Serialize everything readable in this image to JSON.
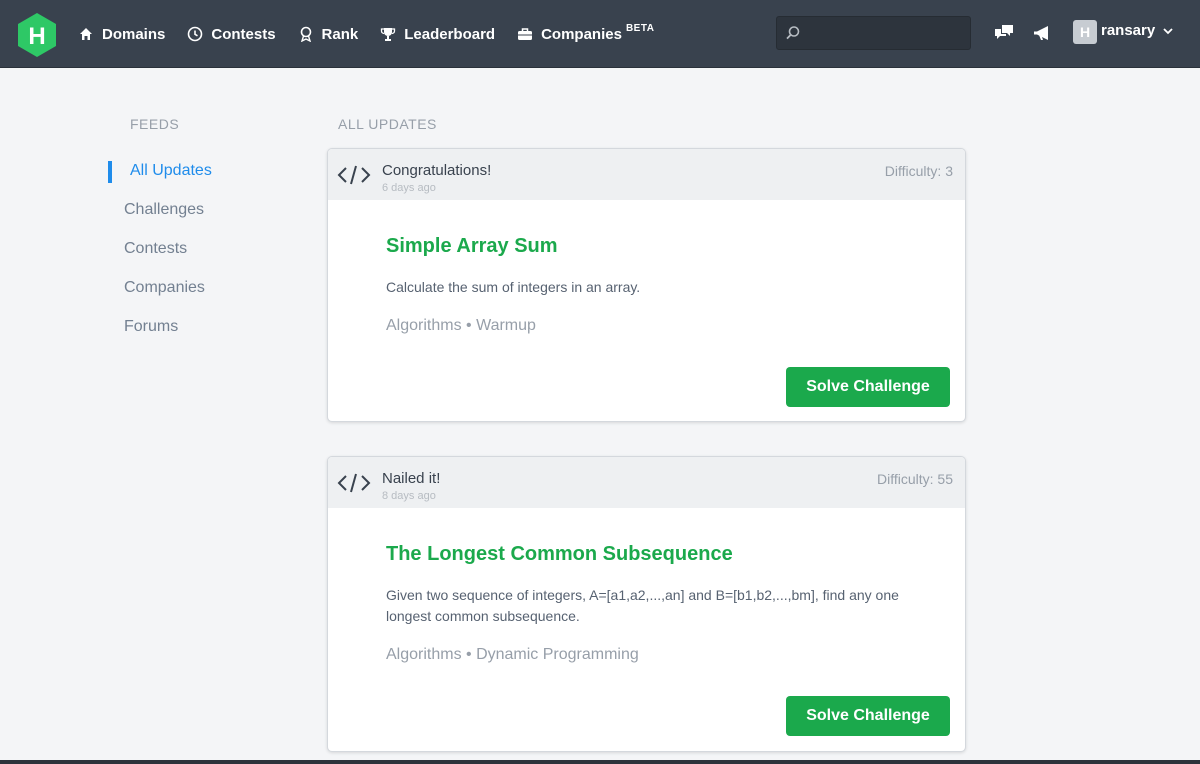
{
  "nav": {
    "logo_letter": "H",
    "items": [
      {
        "label": "Domains",
        "icon": "home-icon"
      },
      {
        "label": "Contests",
        "icon": "clock-icon"
      },
      {
        "label": "Rank",
        "icon": "ribbon-icon"
      },
      {
        "label": "Leaderboard",
        "icon": "trophy-icon"
      },
      {
        "label": "Companies",
        "icon": "briefcase-icon",
        "badge": "BETA"
      }
    ],
    "search_placeholder": "",
    "user": {
      "avatar_letter": "H",
      "name": "ransary"
    }
  },
  "sidebar": {
    "title": "FEEDS",
    "items": [
      {
        "label": "All Updates",
        "active": true
      },
      {
        "label": "Challenges"
      },
      {
        "label": "Contests"
      },
      {
        "label": "Companies"
      },
      {
        "label": "Forums"
      }
    ]
  },
  "main": {
    "title": "ALL UPDATES",
    "cards": [
      {
        "header": "Congratulations!",
        "time": "6 days ago",
        "difficulty": "Difficulty: 3",
        "title": "Simple Array Sum",
        "description": "Calculate the sum of integers in an array.",
        "tags": "Algorithms • Warmup",
        "button": "Solve Challenge"
      },
      {
        "header": "Nailed it!",
        "time": "8 days ago",
        "difficulty": "Difficulty: 55",
        "title": "The Longest Common Subsequence",
        "description": "Given two sequence of integers, A=[a1,a2,...,an] and B=[b1,b2,...,bm], find any one longest common subsequence.",
        "tags": "Algorithms • Dynamic Programming",
        "button": "Solve Challenge"
      }
    ]
  },
  "colors": {
    "nav_bg": "#39424e",
    "brand_green": "#1ba94c",
    "active_blue": "#1f8ceb"
  }
}
